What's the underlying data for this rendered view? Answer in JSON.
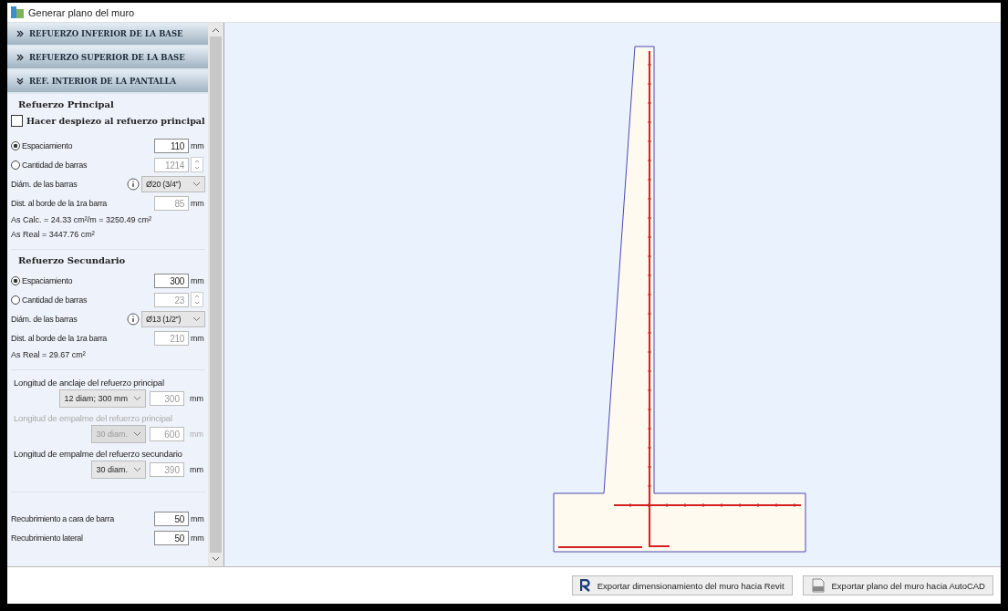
{
  "window": {
    "title": "Generar plano del muro"
  },
  "sections": [
    {
      "title": "REFUERZO INFERIOR DE LA BASE",
      "expanded": false
    },
    {
      "title": "REFUERZO SUPERIOR DE LA BASE",
      "expanded": false
    },
    {
      "title": "REF. INTERIOR DE LA PANTALLA",
      "expanded": true
    }
  ],
  "groups": [
    {
      "heading": "Refuerzo Principal",
      "checkbox": {
        "label": "Hacer despiezo al refuerzo principal",
        "checked": false
      },
      "options": [
        {
          "label": "Espaciamiento",
          "selected": true,
          "value": "110",
          "unit": "mm"
        },
        {
          "label": "Cantidad de barras",
          "selected": false,
          "value": "1214"
        }
      ],
      "diameter": {
        "label": "Diám. de las barras",
        "value": "Ø20 (3/4\")"
      },
      "edge": {
        "label": "Dist. al borde de la 1ra barra",
        "value": "85",
        "unit": "mm",
        "disabled": true
      },
      "notes": [
        "As Calc. = 24.33 cm²/m = 3250.49 cm²",
        "As Real = 3447.76 cm²"
      ]
    },
    {
      "heading": "Refuerzo Secundario",
      "options": [
        {
          "label": "Espaciamiento",
          "selected": true,
          "value": "300",
          "unit": "mm"
        },
        {
          "label": "Cantidad de barras",
          "selected": false,
          "value": "23"
        }
      ],
      "diameter": {
        "label": "Diám. de las barras",
        "value": "Ø13 (1/2\")"
      },
      "edge": {
        "label": "Dist. al borde de la 1ra barra",
        "value": "210",
        "unit": "mm",
        "disabled": true
      },
      "notes": [
        "As Real = 29.67 cm²"
      ]
    }
  ],
  "lengths": [
    {
      "label": "Longitud de anclaje del refuerzo principal",
      "option": "12 diam; 300 mm",
      "value": "300",
      "unit": "mm",
      "disabled": false
    },
    {
      "label": "Longitud de empalme del refuerzo principal",
      "option": "30 diam.",
      "value": "600",
      "unit": "mm",
      "disabled": true
    },
    {
      "label": "Longitud de empalme del refuerzo secundario",
      "option": "30 diam.",
      "value": "390",
      "unit": "mm",
      "disabled": false
    }
  ],
  "covers": [
    {
      "label": "Recubrimiento a cara de barra",
      "value": "50",
      "unit": "mm"
    },
    {
      "label": "Recubrimiento lateral",
      "value": "50",
      "unit": "mm"
    }
  ],
  "buttons": [
    {
      "label": "Exportar dimensionamiento del muro hacia Revit",
      "kind": "revit"
    },
    {
      "label": "Exportar plano del muro hacia AutoCAD",
      "kind": "autocad"
    }
  ]
}
